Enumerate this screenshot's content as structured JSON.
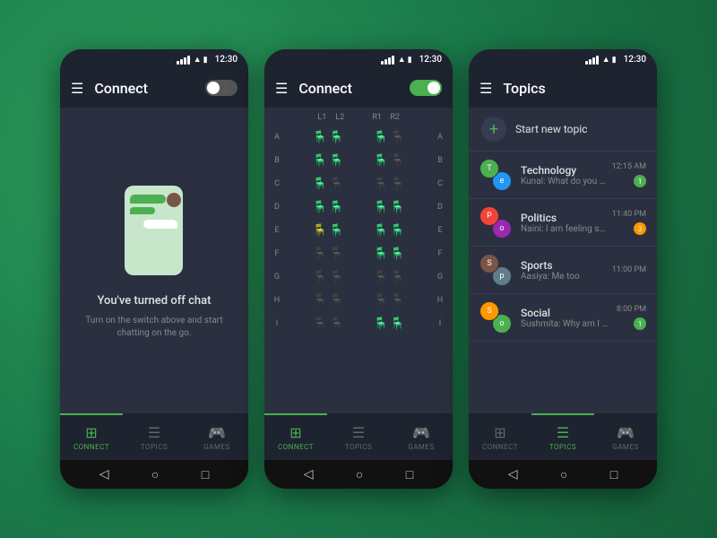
{
  "background": {
    "color": "#1a7a4a"
  },
  "phone1": {
    "statusBar": {
      "time": "12:30"
    },
    "header": {
      "title": "Connect",
      "menu_icon": "☰",
      "toggle_state": "off"
    },
    "content": {
      "chat_off_title": "You've turned off chat",
      "chat_off_subtitle": "Turn on the switch above and start chatting on the go."
    },
    "bottomNav": {
      "items": [
        {
          "label": "CONNECT",
          "active": true
        },
        {
          "label": "TOPICS",
          "active": false
        },
        {
          "label": "GAMES",
          "active": false
        }
      ]
    }
  },
  "phone2": {
    "statusBar": {
      "time": "12:30"
    },
    "header": {
      "title": "Connect",
      "menu_icon": "☰",
      "toggle_state": "on"
    },
    "seatGrid": {
      "colHeaders": [
        "L1",
        "L2",
        "",
        "R1",
        "R2"
      ],
      "rows": [
        {
          "label": "A",
          "seats": [
            "green",
            "green",
            "",
            "green",
            "grey"
          ]
        },
        {
          "label": "B",
          "seats": [
            "green",
            "green",
            "",
            "green",
            "grey"
          ]
        },
        {
          "label": "C",
          "seats": [
            "green",
            "grey",
            "",
            "grey",
            "grey"
          ]
        },
        {
          "label": "D",
          "seats": [
            "green",
            "green",
            "",
            "green",
            "green"
          ]
        },
        {
          "label": "E",
          "seats": [
            "orange",
            "green",
            "",
            "green",
            "green"
          ]
        },
        {
          "label": "F",
          "seats": [
            "grey",
            "grey",
            "",
            "green",
            "green"
          ]
        },
        {
          "label": "G",
          "seats": [
            "grey",
            "grey",
            "",
            "grey",
            "grey"
          ]
        },
        {
          "label": "H",
          "seats": [
            "grey",
            "grey",
            "",
            "grey",
            "grey"
          ]
        },
        {
          "label": "I",
          "seats": [
            "grey",
            "grey",
            "",
            "green",
            "green"
          ]
        }
      ]
    },
    "bottomNav": {
      "items": [
        {
          "label": "CONNECT",
          "active": true
        },
        {
          "label": "TOPICS",
          "active": false
        },
        {
          "label": "GAMES",
          "active": false
        }
      ]
    }
  },
  "phone3": {
    "statusBar": {
      "time": "12:30"
    },
    "header": {
      "title": "Topics",
      "menu_icon": "☰"
    },
    "newTopic": {
      "label": "Start new topic",
      "plus": "+"
    },
    "topics": [
      {
        "name": "Technology",
        "preview": "Kunal: What do you think?",
        "time": "12:15 AM",
        "badge": "1",
        "badge_type": "green",
        "avatar_colors": [
          "#4CAF50",
          "#2196F3"
        ]
      },
      {
        "name": "Politics",
        "preview": "Naini: I am feeling so Noob",
        "time": "11:40 PM",
        "badge": "3",
        "badge_type": "orange",
        "avatar_colors": [
          "#f44336",
          "#9C27B0"
        ]
      },
      {
        "name": "Sports",
        "preview": "Aasiya: Me too",
        "time": "11:00 PM",
        "badge": "",
        "badge_type": "none",
        "avatar_colors": [
          "#795548",
          "#607D8B"
        ]
      },
      {
        "name": "Social",
        "preview": "Sushmita: Why am I here?",
        "time": "8:00 PM",
        "badge": "1",
        "badge_type": "green",
        "avatar_colors": [
          "#FF9800",
          "#4CAF50"
        ]
      }
    ],
    "bottomNav": {
      "items": [
        {
          "label": "CONNECT",
          "active": false
        },
        {
          "label": "TOPICS",
          "active": true
        },
        {
          "label": "GAMES",
          "active": false
        }
      ]
    }
  },
  "androidNav": {
    "back": "◁",
    "home": "○",
    "recent": "□"
  }
}
